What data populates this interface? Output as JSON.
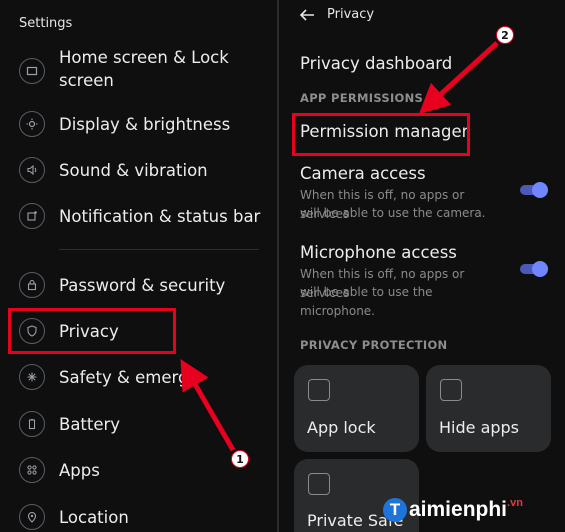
{
  "left": {
    "title": "Settings",
    "items": [
      {
        "label_line1": "Home screen & Lock",
        "label_line2": "screen",
        "icon": "home-screen-icon"
      },
      {
        "label": "Display & brightness",
        "icon": "brightness-icon"
      },
      {
        "label": "Sound & vibration",
        "icon": "sound-icon"
      },
      {
        "label": "Notification & status bar",
        "icon": "notification-icon"
      },
      {
        "label": "Password & security",
        "icon": "lock-icon"
      },
      {
        "label": "Privacy",
        "icon": "shield-icon"
      },
      {
        "label": "Safety & emerge",
        "icon": "safety-icon"
      },
      {
        "label": "Battery",
        "icon": "battery-icon"
      },
      {
        "label": "Apps",
        "icon": "apps-icon"
      },
      {
        "label": "Location",
        "icon": "location-icon"
      }
    ]
  },
  "right": {
    "title": "Privacy",
    "privacy_dashboard": "Privacy dashboard",
    "app_permissions_caption": "APP PERMISSIONS",
    "permission_manager": "Permission manager",
    "camera": {
      "title": "Camera access",
      "sub1": "When this is off, no apps or services",
      "sub2": "will be able to use the camera.",
      "enabled": true
    },
    "microphone": {
      "title": "Microphone access",
      "sub1": "When this is off, no apps or services",
      "sub2": "will be able to use the microphone.",
      "enabled": true
    },
    "privacy_protection_caption": "PRIVACY PROTECTION",
    "tiles": [
      {
        "label": "App lock",
        "icon": "app-lock-icon"
      },
      {
        "label": "Hide apps",
        "icon": "hide-apps-icon"
      },
      {
        "label": "Private Safe",
        "icon": "private-safe-icon"
      }
    ]
  },
  "annotations": {
    "badge1": "1",
    "badge2": "2",
    "highlight_color": "#e8001f"
  },
  "watermark": {
    "logo_letter": "T",
    "brand": "aimienphi",
    "tld": ".vn"
  }
}
